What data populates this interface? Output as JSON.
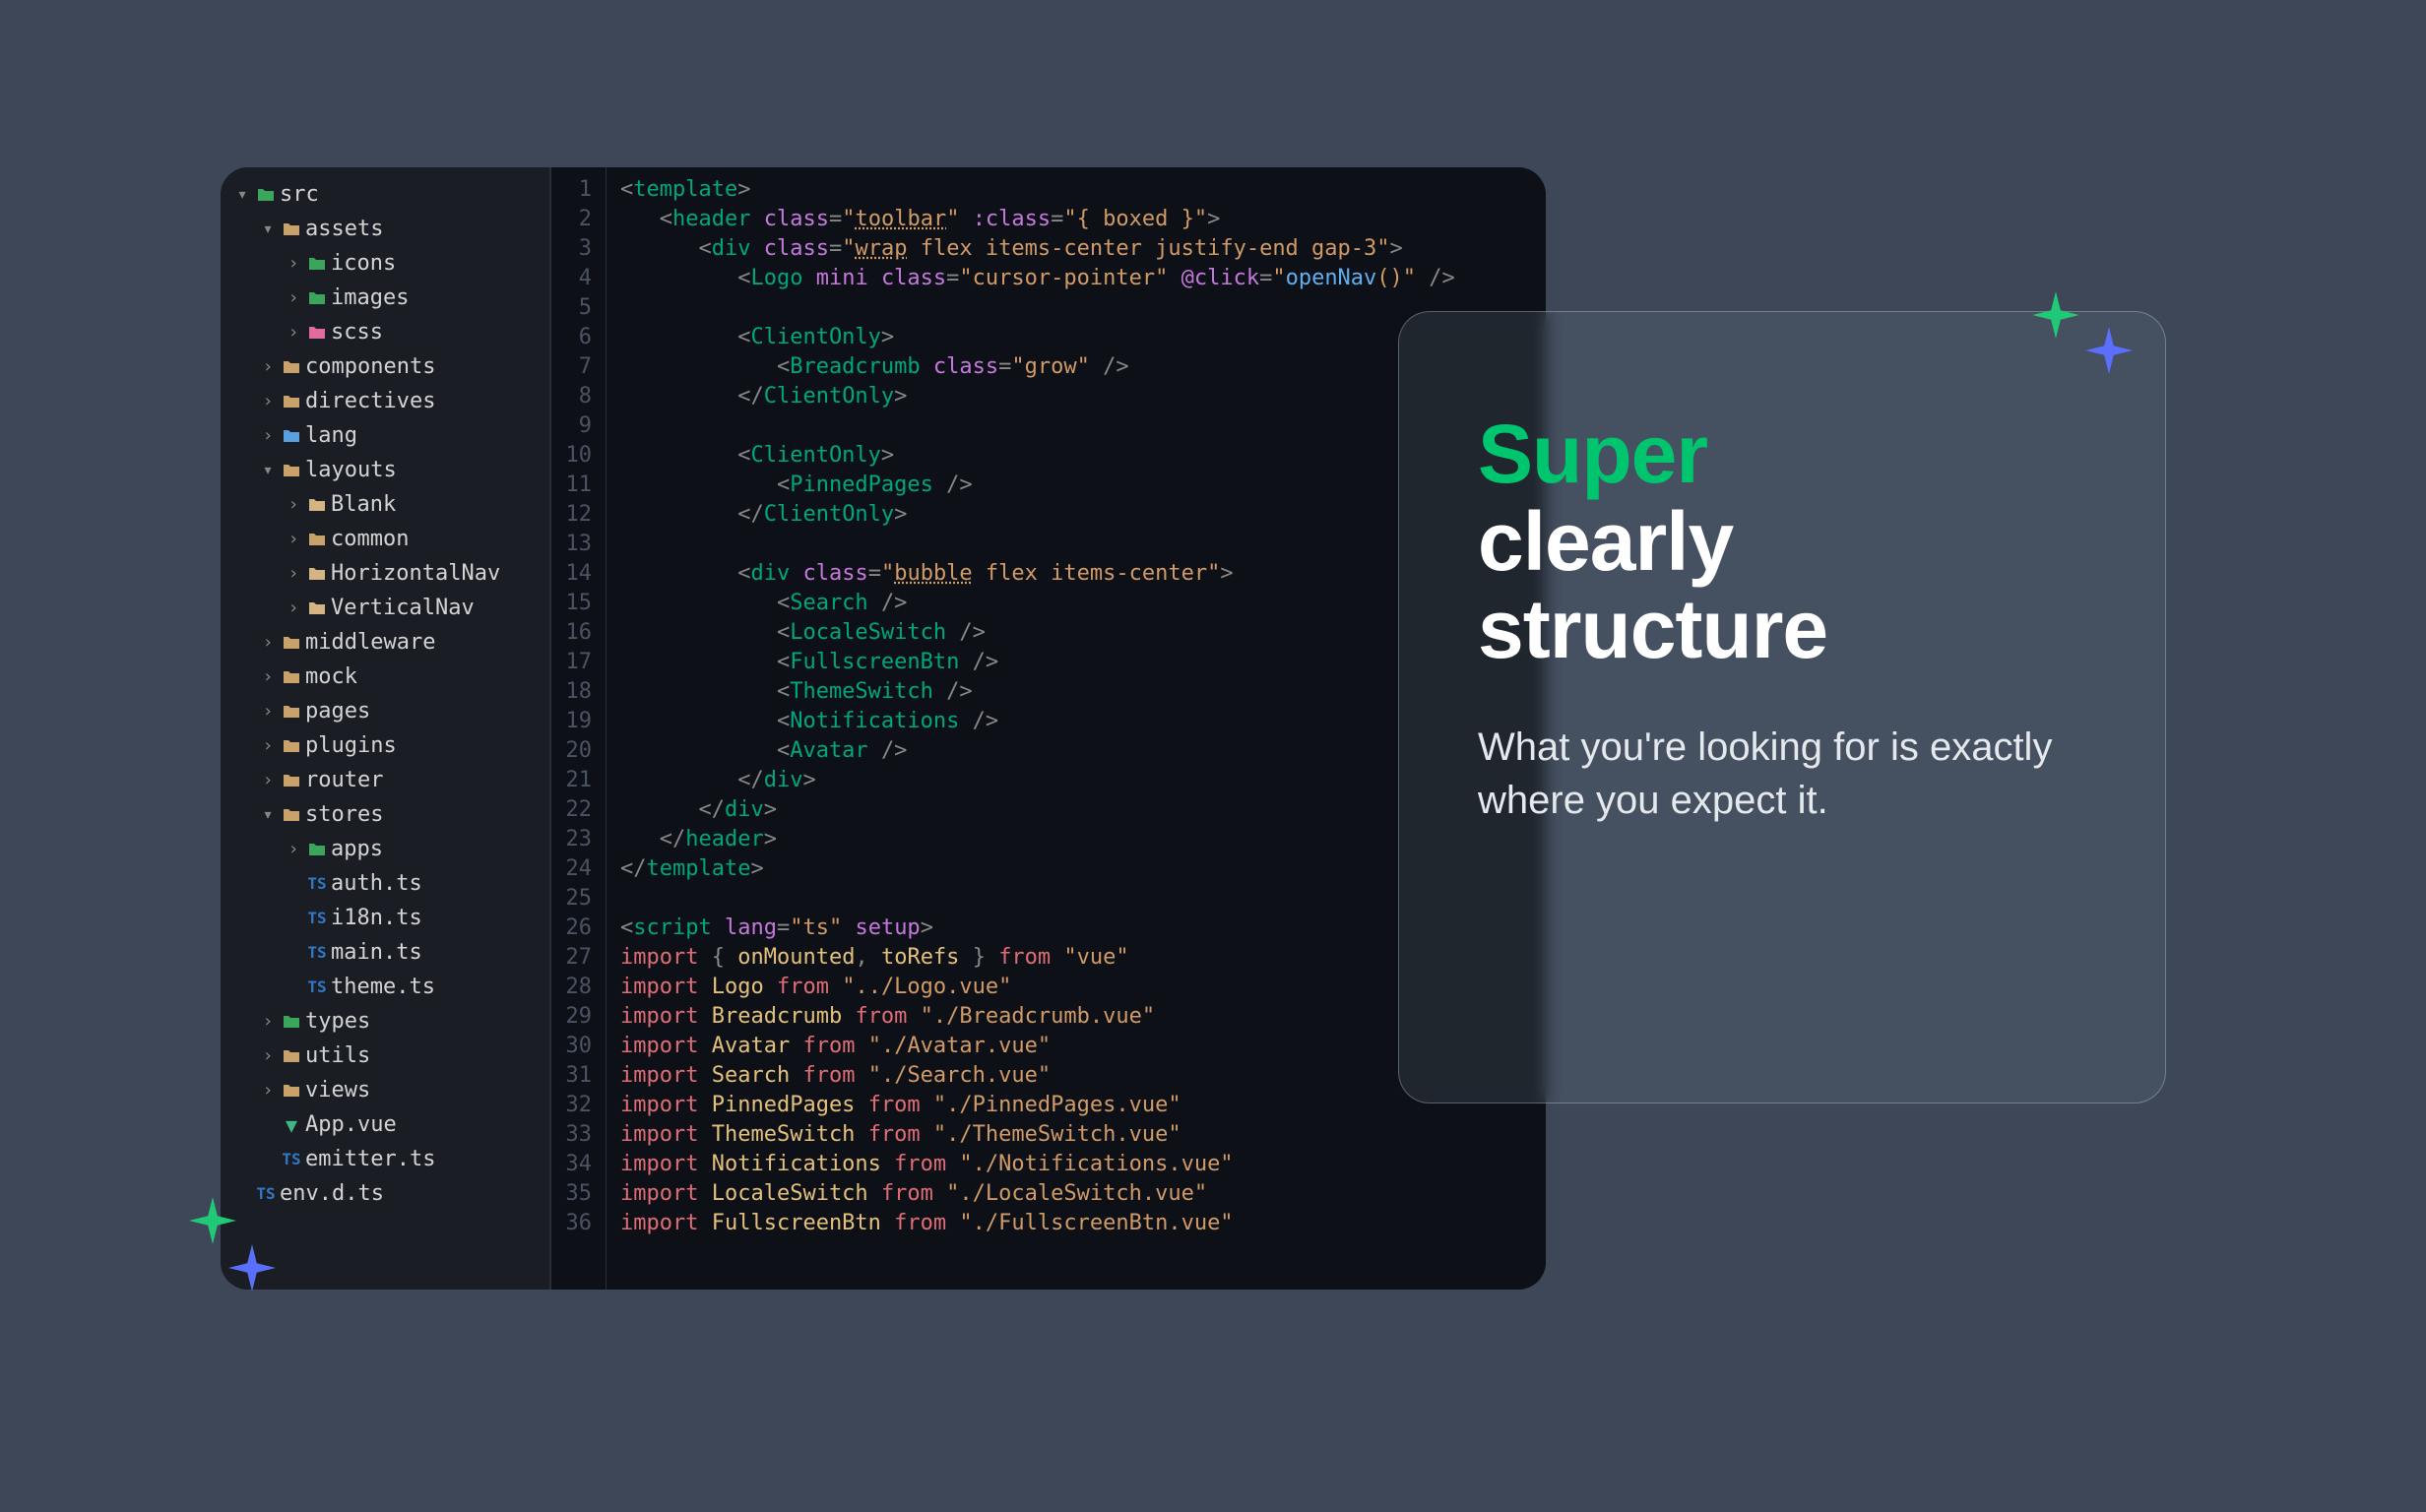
{
  "tree": [
    {
      "d": 0,
      "c": "down",
      "i": "📁",
      "ic": "#3ba55c",
      "l": "src"
    },
    {
      "d": 1,
      "c": "down",
      "i": "📁",
      "ic": "#c9a26b",
      "l": "assets"
    },
    {
      "d": 2,
      "c": "right",
      "i": "📁",
      "ic": "#3ba55c",
      "l": "icons"
    },
    {
      "d": 2,
      "c": "right",
      "i": "📁",
      "ic": "#3ba55c",
      "l": "images"
    },
    {
      "d": 2,
      "c": "right",
      "i": "📁",
      "ic": "#e06c9f",
      "l": "scss"
    },
    {
      "d": 1,
      "c": "right",
      "i": "📁",
      "ic": "#c9a26b",
      "l": "components"
    },
    {
      "d": 1,
      "c": "right",
      "i": "📁",
      "ic": "#c9a26b",
      "l": "directives"
    },
    {
      "d": 1,
      "c": "right",
      "i": "📁",
      "ic": "#5aa0e0",
      "l": "lang"
    },
    {
      "d": 1,
      "c": "down",
      "i": "📁",
      "ic": "#c9a26b",
      "l": "layouts"
    },
    {
      "d": 2,
      "c": "right",
      "i": "📁",
      "ic": "#d4b483",
      "l": "Blank"
    },
    {
      "d": 2,
      "c": "right",
      "i": "📁",
      "ic": "#c9a26b",
      "l": "common"
    },
    {
      "d": 2,
      "c": "right",
      "i": "📁",
      "ic": "#d4b483",
      "l": "HorizontalNav"
    },
    {
      "d": 2,
      "c": "right",
      "i": "📁",
      "ic": "#d4b483",
      "l": "VerticalNav"
    },
    {
      "d": 1,
      "c": "right",
      "i": "📁",
      "ic": "#c9a26b",
      "l": "middleware"
    },
    {
      "d": 1,
      "c": "right",
      "i": "📁",
      "ic": "#c9a26b",
      "l": "mock"
    },
    {
      "d": 1,
      "c": "right",
      "i": "📁",
      "ic": "#c9a26b",
      "l": "pages"
    },
    {
      "d": 1,
      "c": "right",
      "i": "📁",
      "ic": "#c9a26b",
      "l": "plugins"
    },
    {
      "d": 1,
      "c": "right",
      "i": "📁",
      "ic": "#c9a26b",
      "l": "router"
    },
    {
      "d": 1,
      "c": "down",
      "i": "📁",
      "ic": "#c9a26b",
      "l": "stores"
    },
    {
      "d": 2,
      "c": "right",
      "i": "📁",
      "ic": "#3ba55c",
      "l": "apps"
    },
    {
      "d": 2,
      "c": "",
      "i": "TS",
      "ic": "#3178c6",
      "l": "auth.ts"
    },
    {
      "d": 2,
      "c": "",
      "i": "TS",
      "ic": "#3178c6",
      "l": "i18n.ts"
    },
    {
      "d": 2,
      "c": "",
      "i": "TS",
      "ic": "#3178c6",
      "l": "main.ts"
    },
    {
      "d": 2,
      "c": "",
      "i": "TS",
      "ic": "#3178c6",
      "l": "theme.ts"
    },
    {
      "d": 1,
      "c": "right",
      "i": "📁",
      "ic": "#3ba55c",
      "l": "types"
    },
    {
      "d": 1,
      "c": "right",
      "i": "📁",
      "ic": "#c9a26b",
      "l": "utils"
    },
    {
      "d": 1,
      "c": "right",
      "i": "📁",
      "ic": "#c9a26b",
      "l": "views"
    },
    {
      "d": 1,
      "c": "",
      "i": "V",
      "ic": "#41b883",
      "l": "App.vue"
    },
    {
      "d": 1,
      "c": "",
      "i": "TS",
      "ic": "#3178c6",
      "l": "emitter.ts"
    },
    {
      "d": 0,
      "c": "",
      "i": "TS",
      "ic": "#3178c6",
      "l": "env.d.ts"
    }
  ],
  "lines": 36,
  "code": [
    [
      [
        "pun",
        "<"
      ],
      [
        "tag",
        "template"
      ],
      [
        "pun",
        ">"
      ]
    ],
    [
      [
        "txt",
        "   "
      ],
      [
        "pun",
        "<"
      ],
      [
        "tag",
        "header"
      ],
      [
        "txt",
        " "
      ],
      [
        "attr",
        "class"
      ],
      [
        "pun",
        "="
      ],
      [
        "str",
        "\""
      ],
      [
        "str_ul",
        "toolbar"
      ],
      [
        "str",
        "\""
      ],
      [
        "txt",
        " "
      ],
      [
        "attr",
        ":class"
      ],
      [
        "pun",
        "="
      ],
      [
        "str",
        "\"{ boxed }\""
      ],
      [
        "pun",
        ">"
      ]
    ],
    [
      [
        "txt",
        "      "
      ],
      [
        "pun",
        "<"
      ],
      [
        "tag",
        "div"
      ],
      [
        "txt",
        " "
      ],
      [
        "attr",
        "class"
      ],
      [
        "pun",
        "="
      ],
      [
        "str",
        "\""
      ],
      [
        "str_ul",
        "wrap"
      ],
      [
        "str",
        " flex items-center justify-end gap-3\""
      ],
      [
        "pun",
        ">"
      ]
    ],
    [
      [
        "txt",
        "         "
      ],
      [
        "pun",
        "<"
      ],
      [
        "tag",
        "Logo"
      ],
      [
        "txt",
        " "
      ],
      [
        "attr",
        "mini"
      ],
      [
        "txt",
        " "
      ],
      [
        "attr",
        "class"
      ],
      [
        "pun",
        "="
      ],
      [
        "str",
        "\"cursor-pointer\""
      ],
      [
        "txt",
        " "
      ],
      [
        "attr",
        "@click"
      ],
      [
        "pun",
        "="
      ],
      [
        "str",
        "\""
      ],
      [
        "fn",
        "openNav"
      ],
      [
        "str",
        "()\""
      ],
      [
        "txt",
        " "
      ],
      [
        "pun",
        "/>"
      ]
    ],
    [],
    [
      [
        "txt",
        "         "
      ],
      [
        "pun",
        "<"
      ],
      [
        "tag",
        "ClientOnly"
      ],
      [
        "pun",
        ">"
      ]
    ],
    [
      [
        "txt",
        "            "
      ],
      [
        "pun",
        "<"
      ],
      [
        "tag",
        "Breadcrumb"
      ],
      [
        "txt",
        " "
      ],
      [
        "attr",
        "class"
      ],
      [
        "pun",
        "="
      ],
      [
        "str",
        "\"grow\""
      ],
      [
        "txt",
        " "
      ],
      [
        "pun",
        "/>"
      ]
    ],
    [
      [
        "txt",
        "         "
      ],
      [
        "pun",
        "</"
      ],
      [
        "tag",
        "ClientOnly"
      ],
      [
        "pun",
        ">"
      ]
    ],
    [],
    [
      [
        "txt",
        "         "
      ],
      [
        "pun",
        "<"
      ],
      [
        "tag",
        "ClientOnly"
      ],
      [
        "pun",
        ">"
      ]
    ],
    [
      [
        "txt",
        "            "
      ],
      [
        "pun",
        "<"
      ],
      [
        "tag",
        "PinnedPages"
      ],
      [
        "txt",
        " "
      ],
      [
        "pun",
        "/>"
      ]
    ],
    [
      [
        "txt",
        "         "
      ],
      [
        "pun",
        "</"
      ],
      [
        "tag",
        "ClientOnly"
      ],
      [
        "pun",
        ">"
      ]
    ],
    [],
    [
      [
        "txt",
        "         "
      ],
      [
        "pun",
        "<"
      ],
      [
        "tag",
        "div"
      ],
      [
        "txt",
        " "
      ],
      [
        "attr",
        "class"
      ],
      [
        "pun",
        "="
      ],
      [
        "str",
        "\""
      ],
      [
        "str_ul",
        "bubble"
      ],
      [
        "str",
        " flex items-center\""
      ],
      [
        "pun",
        ">"
      ]
    ],
    [
      [
        "txt",
        "            "
      ],
      [
        "pun",
        "<"
      ],
      [
        "tag",
        "Search"
      ],
      [
        "txt",
        " "
      ],
      [
        "pun",
        "/>"
      ]
    ],
    [
      [
        "txt",
        "            "
      ],
      [
        "pun",
        "<"
      ],
      [
        "tag",
        "LocaleSwitch"
      ],
      [
        "txt",
        " "
      ],
      [
        "pun",
        "/>"
      ]
    ],
    [
      [
        "txt",
        "            "
      ],
      [
        "pun",
        "<"
      ],
      [
        "tag",
        "FullscreenBtn"
      ],
      [
        "txt",
        " "
      ],
      [
        "pun",
        "/>"
      ]
    ],
    [
      [
        "txt",
        "            "
      ],
      [
        "pun",
        "<"
      ],
      [
        "tag",
        "ThemeSwitch"
      ],
      [
        "txt",
        " "
      ],
      [
        "pun",
        "/>"
      ]
    ],
    [
      [
        "txt",
        "            "
      ],
      [
        "pun",
        "<"
      ],
      [
        "tag",
        "Notifications"
      ],
      [
        "txt",
        " "
      ],
      [
        "pun",
        "/>"
      ]
    ],
    [
      [
        "txt",
        "            "
      ],
      [
        "pun",
        "<"
      ],
      [
        "tag",
        "Avatar"
      ],
      [
        "txt",
        " "
      ],
      [
        "pun",
        "/>"
      ]
    ],
    [
      [
        "txt",
        "         "
      ],
      [
        "pun",
        "</"
      ],
      [
        "tag",
        "div"
      ],
      [
        "pun",
        ">"
      ]
    ],
    [
      [
        "txt",
        "      "
      ],
      [
        "pun",
        "</"
      ],
      [
        "tag",
        "div"
      ],
      [
        "pun",
        ">"
      ]
    ],
    [
      [
        "txt",
        "   "
      ],
      [
        "pun",
        "</"
      ],
      [
        "tag",
        "header"
      ],
      [
        "pun",
        ">"
      ]
    ],
    [
      [
        "pun",
        "</"
      ],
      [
        "tag",
        "template"
      ],
      [
        "pun",
        ">"
      ]
    ],
    [],
    [
      [
        "pun",
        "<"
      ],
      [
        "tag",
        "script"
      ],
      [
        "txt",
        " "
      ],
      [
        "attr",
        "lang"
      ],
      [
        "pun",
        "="
      ],
      [
        "str",
        "\"ts\""
      ],
      [
        "txt",
        " "
      ],
      [
        "attr",
        "setup"
      ],
      [
        "pun",
        ">"
      ]
    ],
    [
      [
        "kw",
        "import"
      ],
      [
        "txt",
        " "
      ],
      [
        "pun",
        "{"
      ],
      [
        "txt",
        " "
      ],
      [
        "var",
        "onMounted"
      ],
      [
        "pun",
        ","
      ],
      [
        "txt",
        " "
      ],
      [
        "var",
        "toRefs"
      ],
      [
        "txt",
        " "
      ],
      [
        "pun",
        "}"
      ],
      [
        "txt",
        " "
      ],
      [
        "kw",
        "from"
      ],
      [
        "txt",
        " "
      ],
      [
        "str",
        "\"vue\""
      ]
    ],
    [
      [
        "kw",
        "import"
      ],
      [
        "txt",
        " "
      ],
      [
        "var",
        "Logo"
      ],
      [
        "txt",
        " "
      ],
      [
        "kw",
        "from"
      ],
      [
        "txt",
        " "
      ],
      [
        "str",
        "\"../Logo.vue\""
      ]
    ],
    [
      [
        "kw",
        "import"
      ],
      [
        "txt",
        " "
      ],
      [
        "var",
        "Breadcrumb"
      ],
      [
        "txt",
        " "
      ],
      [
        "kw",
        "from"
      ],
      [
        "txt",
        " "
      ],
      [
        "str",
        "\"./Breadcrumb.vue\""
      ]
    ],
    [
      [
        "kw",
        "import"
      ],
      [
        "txt",
        " "
      ],
      [
        "var",
        "Avatar"
      ],
      [
        "txt",
        " "
      ],
      [
        "kw",
        "from"
      ],
      [
        "txt",
        " "
      ],
      [
        "str",
        "\"./Avatar.vue\""
      ]
    ],
    [
      [
        "kw",
        "import"
      ],
      [
        "txt",
        " "
      ],
      [
        "var",
        "Search"
      ],
      [
        "txt",
        " "
      ],
      [
        "kw",
        "from"
      ],
      [
        "txt",
        " "
      ],
      [
        "str",
        "\"./Search.vue\""
      ]
    ],
    [
      [
        "kw",
        "import"
      ],
      [
        "txt",
        " "
      ],
      [
        "var",
        "PinnedPages"
      ],
      [
        "txt",
        " "
      ],
      [
        "kw",
        "from"
      ],
      [
        "txt",
        " "
      ],
      [
        "str",
        "\"./PinnedPages.vue\""
      ]
    ],
    [
      [
        "kw",
        "import"
      ],
      [
        "txt",
        " "
      ],
      [
        "var",
        "ThemeSwitch"
      ],
      [
        "txt",
        " "
      ],
      [
        "kw",
        "from"
      ],
      [
        "txt",
        " "
      ],
      [
        "str",
        "\"./ThemeSwitch.vue\""
      ]
    ],
    [
      [
        "kw",
        "import"
      ],
      [
        "txt",
        " "
      ],
      [
        "var",
        "Notifications"
      ],
      [
        "txt",
        " "
      ],
      [
        "kw",
        "from"
      ],
      [
        "txt",
        " "
      ],
      [
        "str",
        "\"./Notifications.vue\""
      ]
    ],
    [
      [
        "kw",
        "import"
      ],
      [
        "txt",
        " "
      ],
      [
        "var",
        "LocaleSwitch"
      ],
      [
        "txt",
        " "
      ],
      [
        "kw",
        "from"
      ],
      [
        "txt",
        " "
      ],
      [
        "str",
        "\"./LocaleSwitch.vue\""
      ]
    ],
    [
      [
        "kw",
        "import"
      ],
      [
        "txt",
        " "
      ],
      [
        "var",
        "FullscreenBtn"
      ],
      [
        "txt",
        " "
      ],
      [
        "kw",
        "from"
      ],
      [
        "txt",
        " "
      ],
      [
        "str",
        "\"./FullscreenBtn.vue\""
      ]
    ]
  ],
  "card": {
    "h1a": "Super",
    "h1b": "clearly structure",
    "sub": "What you're looking for is exactly where you expect it."
  }
}
